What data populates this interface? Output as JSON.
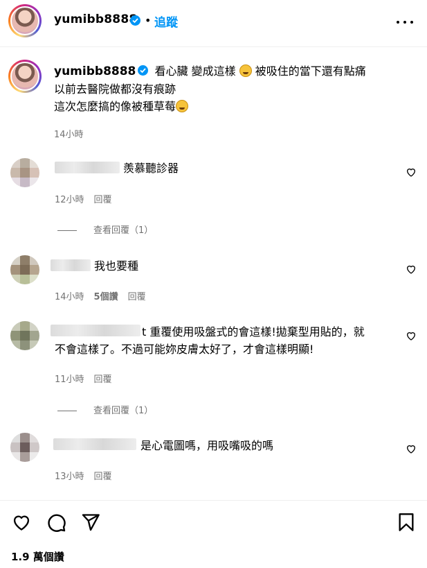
{
  "post": {
    "username": "yumibb8888",
    "separator": "•",
    "follow_label": "追蹤",
    "caption_part1": "看心臟 變成這樣",
    "caption_part2": "被吸住的當下還有點痛",
    "caption_line2": "以前去醫院做都沒有痕跡",
    "caption_line3": "這次怎麼搞的像被種草莓",
    "time": "14小時",
    "like_count": "1.9 萬個讚"
  },
  "comments": [
    {
      "text": "羨慕聽診器",
      "time": "12小時",
      "likes": "",
      "reply_label": "回覆",
      "view_replies": "查看回覆（1）"
    },
    {
      "text": "我也要種",
      "time": "14小時",
      "likes": "5個讚",
      "reply_label": "回覆",
      "view_replies": ""
    },
    {
      "text_prefix": "t",
      "text": "重覆使用吸盤式的會這樣!拋棄型用貼的，就",
      "text_line2": "不會這樣了。不過可能妳皮膚太好了，才會這樣明顯!",
      "time": "11小時",
      "likes": "",
      "reply_label": "回覆",
      "view_replies": "查看回覆（1）"
    },
    {
      "text": "是心電圖嗎，用吸嘴吸的嗎",
      "time": "13小時",
      "likes": "",
      "reply_label": "回覆",
      "view_replies": ""
    }
  ],
  "icons": {
    "verified": "verified-badge-icon",
    "more": "more-options-icon",
    "heart": "heart-icon",
    "comment": "comment-icon",
    "share": "share-icon",
    "save": "bookmark-icon",
    "emoji1": "grinning-squint-emoji",
    "emoji2": "smiling-emoji"
  },
  "colors": {
    "accent": "#0095f6",
    "secondary_text": "#737373",
    "divider": "#efefef"
  }
}
